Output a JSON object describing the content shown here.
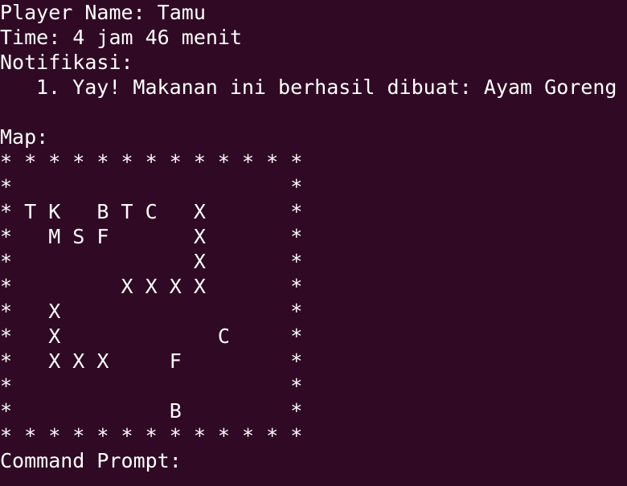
{
  "header": {
    "player_name_label": "Player Name: Tamu",
    "time_label": "Time: 4 jam 46 menit",
    "notification_heading": "Notifikasi:",
    "notifications": [
      "1. Yay! Makanan ini berhasil dibuat: Ayam Goreng"
    ]
  },
  "map": {
    "heading": "Map:",
    "rows": [
      "* * * * * * * * * * * * *",
      "*                       *",
      "* T K   B T C   X       *",
      "*   M S F       X       *",
      "*               X       *",
      "*         X X X X       *",
      "*   X                   *",
      "*   X             C     *",
      "*   X X X     F         *",
      "*                       *",
      "*             B         *",
      "* * * * * * * * * * * * *"
    ]
  },
  "prompt": {
    "label": "Command Prompt:"
  },
  "colors": {
    "background": "#300a24",
    "text": "#ffffff"
  }
}
